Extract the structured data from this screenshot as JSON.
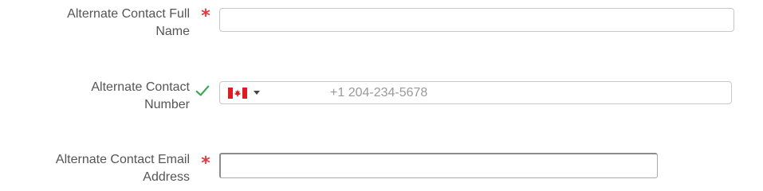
{
  "form": {
    "fields": [
      {
        "label_line1": "Alternate Contact Full",
        "label_line2": "Name",
        "marker": "required",
        "marker_symbol": "*",
        "value": ""
      },
      {
        "label_line1": "Alternate Contact",
        "label_line2": "Number",
        "marker": "valid",
        "marker_icon": "check-icon",
        "country_flag": "canada-flag-icon",
        "placeholder": "+1 204-234-5678",
        "value": ""
      },
      {
        "label_line1": "Alternate Contact Email",
        "label_line2": "Address",
        "marker": "required",
        "marker_symbol": "*",
        "value": ""
      }
    ]
  },
  "colors": {
    "required": "#e5373b",
    "valid": "#3aa655",
    "label": "#555555",
    "placeholder": "#999999",
    "flag_red": "#e01a22"
  }
}
